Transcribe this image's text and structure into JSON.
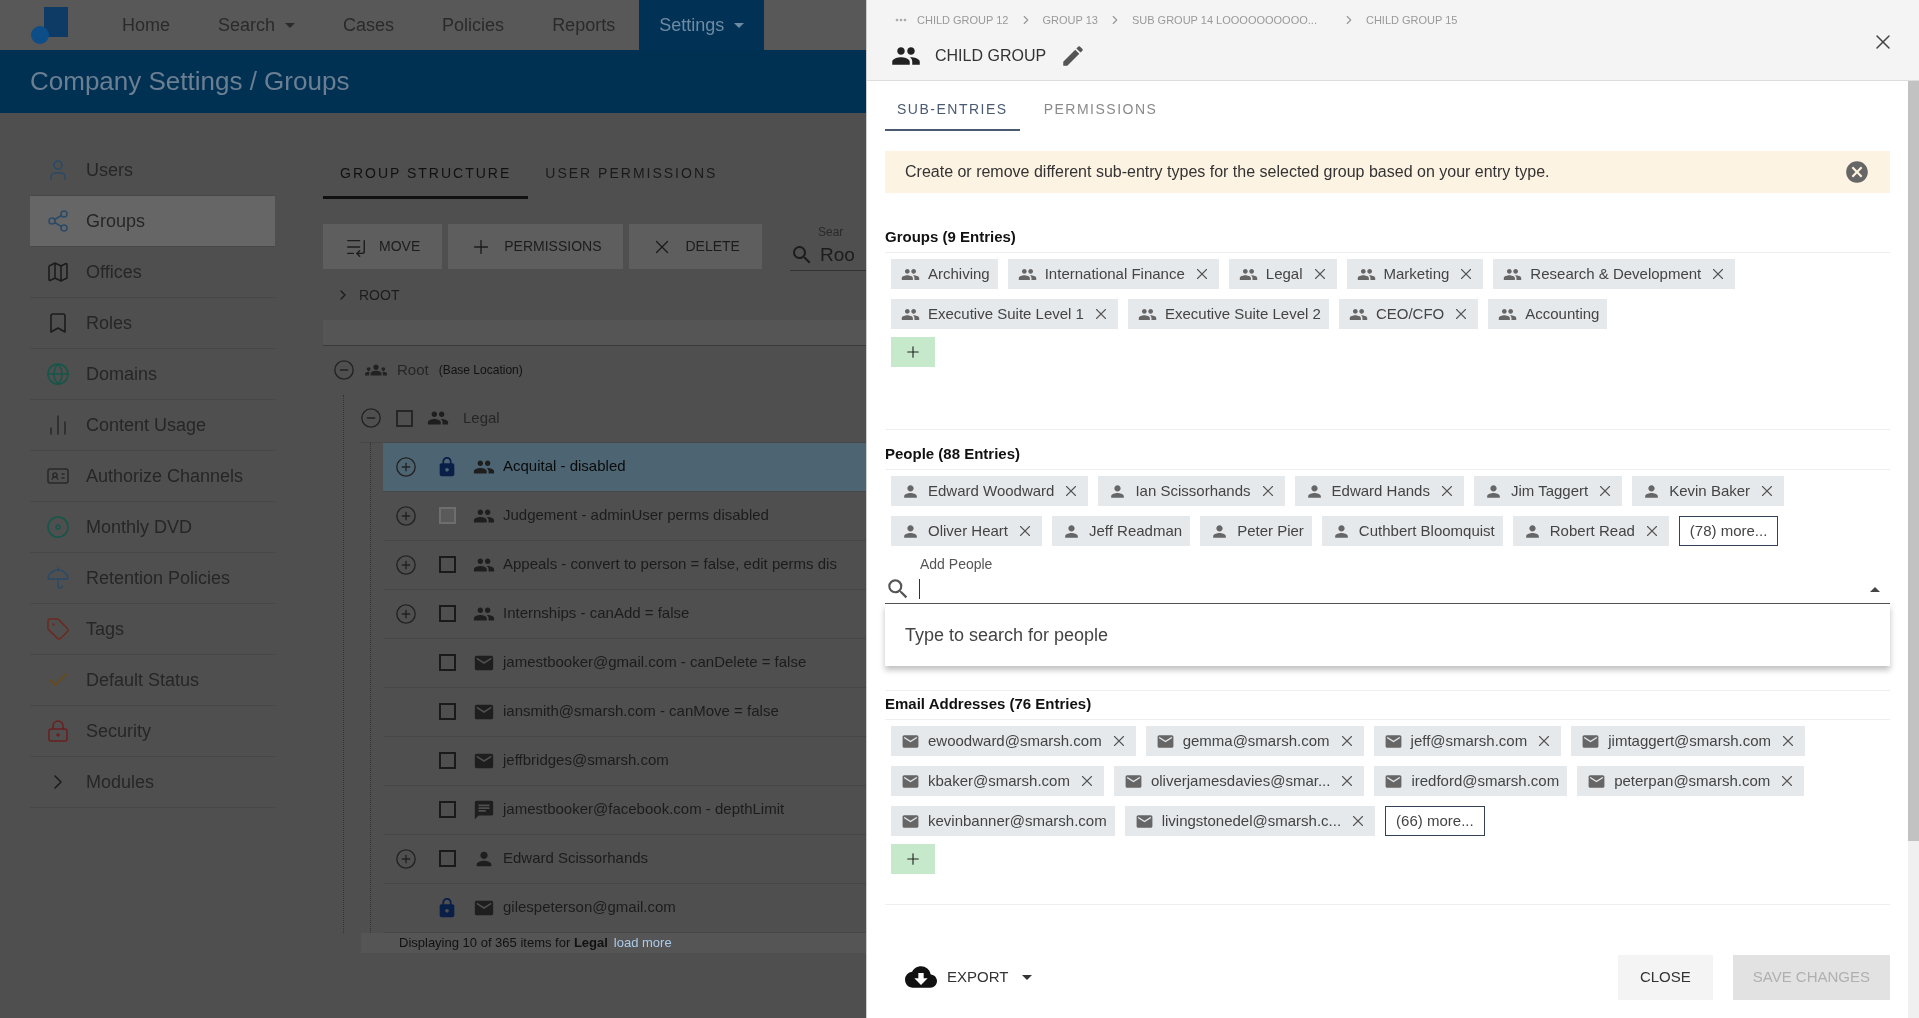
{
  "nav": {
    "items": [
      {
        "label": "Home",
        "dropdown": false,
        "selected": false
      },
      {
        "label": "Search",
        "dropdown": true,
        "selected": false
      },
      {
        "label": "Cases",
        "dropdown": false,
        "selected": false
      },
      {
        "label": "Policies",
        "dropdown": false,
        "selected": false
      },
      {
        "label": "Reports",
        "dropdown": false,
        "selected": false
      },
      {
        "label": "Settings",
        "dropdown": true,
        "selected": true
      }
    ]
  },
  "page_title": "Company Settings / Groups",
  "sidebar": {
    "items": [
      {
        "label": "Users",
        "selected": false
      },
      {
        "label": "Groups",
        "selected": true
      },
      {
        "label": "Offices",
        "selected": false
      },
      {
        "label": "Roles",
        "selected": false
      },
      {
        "label": "Domains",
        "selected": false
      },
      {
        "label": "Content Usage",
        "selected": false
      },
      {
        "label": "Authorize Channels",
        "selected": false
      },
      {
        "label": "Monthly DVD",
        "selected": false
      },
      {
        "label": "Retention Policies",
        "selected": false
      },
      {
        "label": "Tags",
        "selected": false
      },
      {
        "label": "Default Status",
        "selected": false
      },
      {
        "label": "Security",
        "selected": false
      },
      {
        "label": "Modules",
        "selected": false
      }
    ]
  },
  "main_tabs": [
    {
      "label": "GROUP STRUCTURE",
      "selected": true
    },
    {
      "label": "USER PERMISSIONS",
      "selected": false
    }
  ],
  "toolbar": [
    {
      "label": "MOVE",
      "disabled": true
    },
    {
      "label": "PERMISSIONS",
      "disabled": true
    },
    {
      "label": "DELETE",
      "disabled": true
    }
  ],
  "search": {
    "label": "Sear",
    "value": "Roo"
  },
  "breadcrumb": "ROOT",
  "tree": {
    "label": "Root",
    "note": "(Base Location)",
    "expanded": true,
    "children": [
      {
        "label": "Legal",
        "expanded": true,
        "checked": false,
        "children": [
          {
            "label": "Acquital - disabled",
            "kind": "group",
            "expandable": true,
            "locked": true,
            "selected": true
          },
          {
            "label": "Judgement - adminUser perms disabled",
            "kind": "group",
            "expandable": true,
            "locked": false,
            "selected": false,
            "disabled": true,
            "checked": false
          },
          {
            "label": "Appeals - convert to person = false, edit perms dis",
            "kind": "group",
            "expandable": true,
            "locked": false,
            "selected": false,
            "disabled": false,
            "checked": false
          },
          {
            "label": "Internships - canAdd = false",
            "kind": "group",
            "expandable": true,
            "locked": false,
            "selected": false,
            "disabled": false,
            "checked": false
          },
          {
            "label": "jamestbooker@gmail.com - canDelete = false",
            "kind": "email",
            "expandable": false,
            "locked": false,
            "selected": false,
            "disabled": false,
            "checked": false
          },
          {
            "label": "iansmith@smarsh.com - canMove = false",
            "kind": "email",
            "expandable": false,
            "locked": false,
            "selected": false,
            "disabled": false,
            "checked": false
          },
          {
            "label": "jeffbridges@smarsh.com",
            "kind": "email",
            "expandable": false,
            "locked": false,
            "selected": false,
            "disabled": false,
            "checked": false
          },
          {
            "label": "jamestbooker@facebook.com - depthLimit",
            "kind": "chat",
            "expandable": false,
            "locked": false,
            "selected": false,
            "disabled": false,
            "checked": false
          },
          {
            "label": "Edward Scissorhands",
            "kind": "person",
            "expandable": true,
            "locked": false,
            "selected": false,
            "disabled": false,
            "checked": false
          },
          {
            "label": "gilespeterson@gmail.com",
            "kind": "email",
            "expandable": false,
            "locked": true,
            "selected": false
          }
        ]
      }
    ]
  },
  "tree_footer": {
    "text": "Displaying 10 of 365 items for **Legal**",
    "link": "load more"
  },
  "panel": {
    "breadcrumb": [
      "CHILD GROUP 12",
      "GROUP 13",
      "SUB GROUP 14 LOOOOOOOOOO...",
      "CHILD GROUP 15"
    ],
    "title": "CHILD GROUP",
    "tabs": [
      {
        "label": "SUB-ENTRIES",
        "selected": true
      },
      {
        "label": "PERMISSIONS",
        "selected": false
      }
    ],
    "alert": "Create or remove different sub-entry types for the selected group based on your entry type.",
    "sections": [
      {
        "title": "Groups (9 Entries)",
        "kind": "group",
        "chips": [
          {
            "label": "Archiving",
            "removable": false
          },
          {
            "label": "International Finance",
            "removable": true
          },
          {
            "label": "Legal",
            "removable": true
          },
          {
            "label": "Marketing",
            "removable": true
          },
          {
            "label": "Research & Development",
            "removable": true
          },
          {
            "label": "Executive Suite Level 1",
            "removable": true
          },
          {
            "label": "Executive Suite Level 2",
            "removable": false
          },
          {
            "label": "CEO/CFO",
            "removable": true
          },
          {
            "label": "Accounting",
            "removable": false
          }
        ],
        "add_button": true
      },
      {
        "title": "People (88 Entries)",
        "kind": "person",
        "chips": [
          {
            "label": "Edward Woodward",
            "removable": true
          },
          {
            "label": "Ian Scissorhands",
            "removable": true
          },
          {
            "label": "Edward Hands",
            "removable": true
          },
          {
            "label": "Jim Taggert",
            "removable": true
          },
          {
            "label": "Kevin Baker",
            "removable": true
          },
          {
            "label": "Oliver Heart",
            "removable": true
          },
          {
            "label": "Jeff Readman",
            "removable": false
          },
          {
            "label": "Peter Pier",
            "removable": false
          },
          {
            "label": "Cuthbert Bloomquist",
            "removable": false
          },
          {
            "label": "Robert Read",
            "removable": true
          }
        ],
        "more": "(78) more...",
        "search": {
          "label": "Add People",
          "hint": "Type to search for people",
          "expanded": true
        }
      },
      {
        "title": "Email Addresses (76 Entries)",
        "kind": "email",
        "chips": [
          {
            "label": "ewoodward@smarsh.com",
            "removable": true
          },
          {
            "label": "gemma@smarsh.com",
            "removable": true
          },
          {
            "label": "jeff@smarsh.com",
            "removable": true
          },
          {
            "label": "jimtaggert@smarsh.com",
            "removable": true
          },
          {
            "label": "kbaker@smarsh.com",
            "removable": true
          },
          {
            "label": "oliverjamesdavies@smar...",
            "removable": true
          },
          {
            "label": "iredford@smarsh.com",
            "removable": false
          },
          {
            "label": "peterpan@smarsh.com",
            "removable": true
          },
          {
            "label": "kevinbanner@smarsh.com",
            "removable": false
          },
          {
            "label": "livingstonedel@smarsh.c...",
            "removable": true
          }
        ],
        "more": "(66) more...",
        "add_button": true
      }
    ],
    "footer": {
      "export": "EXPORT",
      "close": "CLOSE",
      "save": {
        "label": "SAVE CHANGES",
        "disabled": true
      }
    }
  }
}
